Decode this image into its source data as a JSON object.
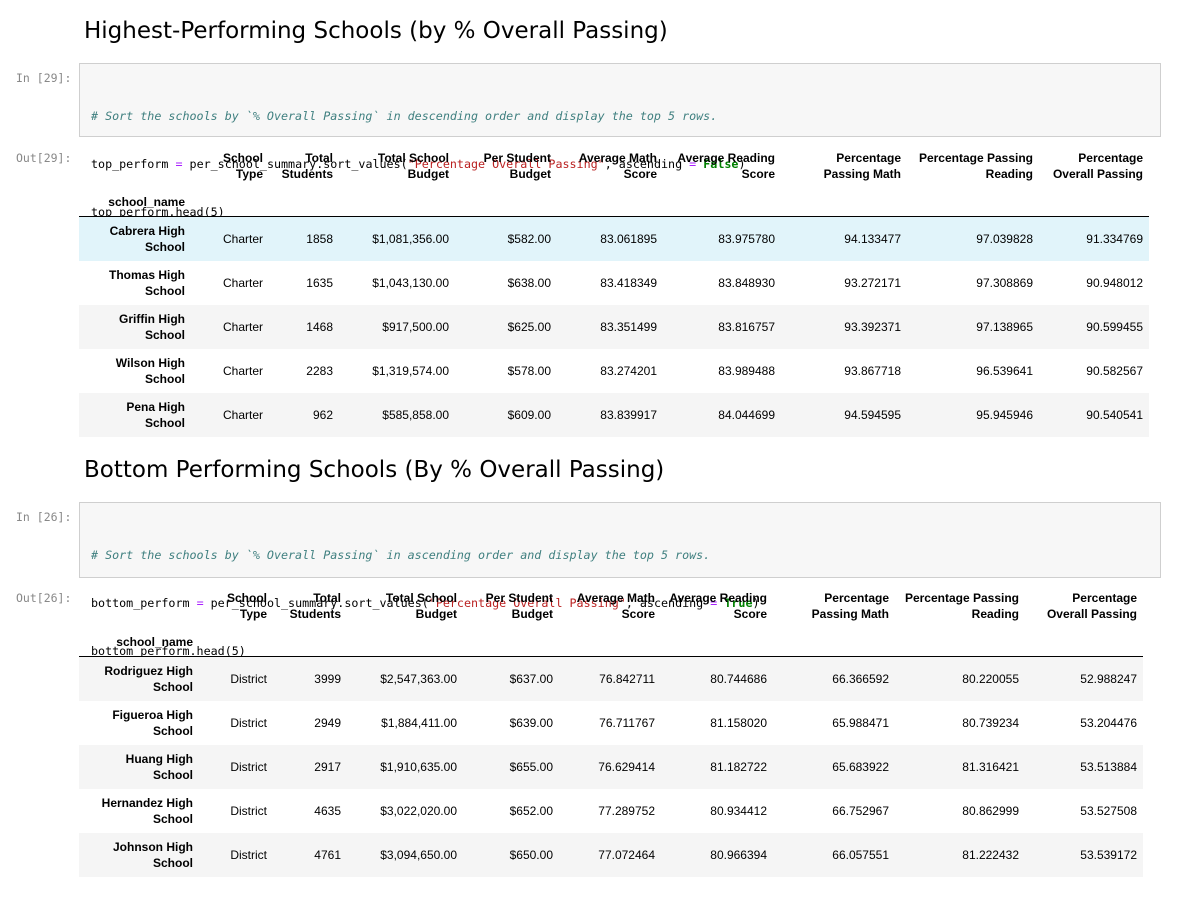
{
  "sections": {
    "top": {
      "heading": "Highest-Performing Schools (by % Overall Passing)",
      "in_prompt": "In [29]:",
      "out_prompt": "Out[29]:",
      "code": {
        "comment": "# Sort the schools by `% Overall Passing` in descending order and display the top 5 rows.",
        "line2_a": "top_perform ",
        "line2_eq": "=",
        "line2_b": " per_school_summary.sort_values(",
        "line2_str": "\"Percentage Overall Passing\"",
        "line2_c": ", ascending ",
        "line2_eq2": "=",
        "line2_sp": " ",
        "line2_kw": "False",
        "line2_d": ")",
        "line3": "top_perform.head(5)"
      },
      "index_name": "school_name",
      "rows": [
        {
          "name": "Cabrera High School",
          "type": "Charter",
          "students": "1858",
          "budget": "$1,081,356.00",
          "per_student": "$582.00",
          "math": "83.061895",
          "reading": "83.975780",
          "pct_math": "94.133477",
          "pct_reading": "97.039828",
          "pct_overall": "91.334769"
        },
        {
          "name": "Thomas High School",
          "type": "Charter",
          "students": "1635",
          "budget": "$1,043,130.00",
          "per_student": "$638.00",
          "math": "83.418349",
          "reading": "83.848930",
          "pct_math": "93.272171",
          "pct_reading": "97.308869",
          "pct_overall": "90.948012"
        },
        {
          "name": "Griffin High School",
          "type": "Charter",
          "students": "1468",
          "budget": "$917,500.00",
          "per_student": "$625.00",
          "math": "83.351499",
          "reading": "83.816757",
          "pct_math": "93.392371",
          "pct_reading": "97.138965",
          "pct_overall": "90.599455"
        },
        {
          "name": "Wilson High School",
          "type": "Charter",
          "students": "2283",
          "budget": "$1,319,574.00",
          "per_student": "$578.00",
          "math": "83.274201",
          "reading": "83.989488",
          "pct_math": "93.867718",
          "pct_reading": "96.539641",
          "pct_overall": "90.582567"
        },
        {
          "name": "Pena High School",
          "type": "Charter",
          "students": "962",
          "budget": "$585,858.00",
          "per_student": "$609.00",
          "math": "83.839917",
          "reading": "84.044699",
          "pct_math": "94.594595",
          "pct_reading": "95.945946",
          "pct_overall": "90.540541"
        }
      ]
    },
    "bottom": {
      "heading": "Bottom Performing Schools (By % Overall Passing)",
      "in_prompt": "In [26]:",
      "out_prompt": "Out[26]:",
      "code": {
        "comment": "# Sort the schools by `% Overall Passing` in ascending order and display the top 5 rows.",
        "line2_a": "bottom_perform ",
        "line2_eq": "=",
        "line2_b": " per_school_summary.sort_values(",
        "line2_str": "\"Percentage Overall Passing\"",
        "line2_c": ", ascending ",
        "line2_eq2": "=",
        "line2_sp": " ",
        "line2_kw": "True",
        "line2_d": ")",
        "line3": "bottom_perform.head(5)"
      },
      "index_name": "school_name",
      "rows": [
        {
          "name": "Rodriguez High School",
          "type": "District",
          "students": "3999",
          "budget": "$2,547,363.00",
          "per_student": "$637.00",
          "math": "76.842711",
          "reading": "80.744686",
          "pct_math": "66.366592",
          "pct_reading": "80.220055",
          "pct_overall": "52.988247"
        },
        {
          "name": "Figueroa High School",
          "type": "District",
          "students": "2949",
          "budget": "$1,884,411.00",
          "per_student": "$639.00",
          "math": "76.711767",
          "reading": "81.158020",
          "pct_math": "65.988471",
          "pct_reading": "80.739234",
          "pct_overall": "53.204476"
        },
        {
          "name": "Huang High School",
          "type": "District",
          "students": "2917",
          "budget": "$1,910,635.00",
          "per_student": "$655.00",
          "math": "76.629414",
          "reading": "81.182722",
          "pct_math": "65.683922",
          "pct_reading": "81.316421",
          "pct_overall": "53.513884"
        },
        {
          "name": "Hernandez High School",
          "type": "District",
          "students": "4635",
          "budget": "$3,022,020.00",
          "per_student": "$652.00",
          "math": "77.289752",
          "reading": "80.934412",
          "pct_math": "66.752967",
          "pct_reading": "80.862999",
          "pct_overall": "53.527508"
        },
        {
          "name": "Johnson High School",
          "type": "District",
          "students": "4761",
          "budget": "$3,094,650.00",
          "per_student": "$650.00",
          "math": "77.072464",
          "reading": "80.966394",
          "pct_math": "66.057551",
          "pct_reading": "81.222432",
          "pct_overall": "53.539172"
        }
      ]
    }
  },
  "columns": [
    {
      "key": "type",
      "label": "School Type"
    },
    {
      "key": "students",
      "label": "Total Students"
    },
    {
      "key": "budget",
      "label": "Total School Budget"
    },
    {
      "key": "per_student",
      "label": "Per Student Budget"
    },
    {
      "key": "math",
      "label": "Average Math Score"
    },
    {
      "key": "reading",
      "label": "Average Reading Score"
    },
    {
      "key": "pct_math",
      "label": "Percentage Passing Math"
    },
    {
      "key": "pct_reading",
      "label": "Percentage Passing Reading"
    },
    {
      "key": "pct_overall",
      "label": "Percentage Overall Passing"
    }
  ],
  "colors": {
    "highlight_row": "#e1f4fa",
    "stripe_row": "#f5f5f5",
    "code_bg": "#f7f7f7",
    "prompt": "#888888"
  }
}
